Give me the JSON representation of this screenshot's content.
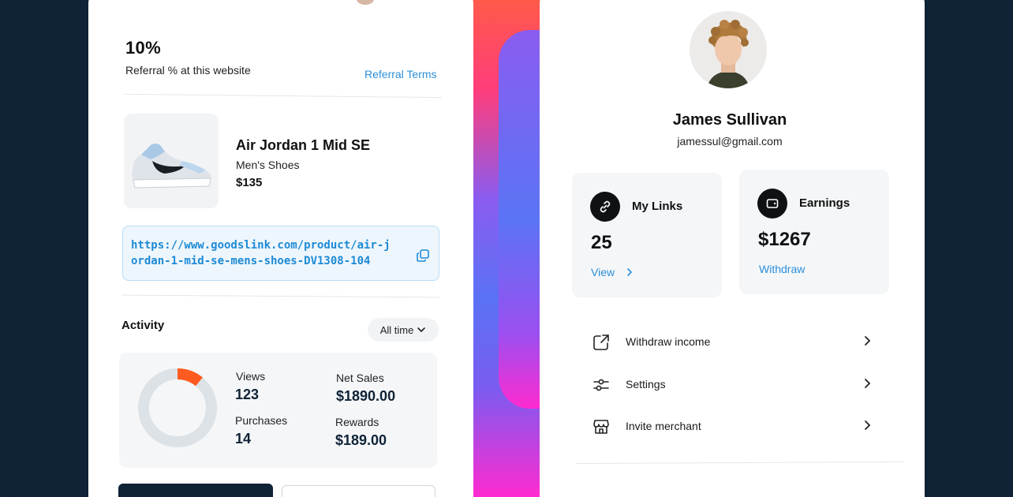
{
  "referral": {
    "percent": "10%",
    "subtitle": "Referral % at this website",
    "terms_link": "Referral Terms"
  },
  "product": {
    "name": "Air Jordan 1 Mid SE",
    "category": "Men's Shoes",
    "price": "$135",
    "link": "https://www.goodslink.com/product/air-jordan-1-mid-se-mens-shoes-DV1308-104"
  },
  "activity": {
    "title": "Activity",
    "filter": "All time",
    "progress_fraction": 0.11,
    "stats": [
      {
        "label": "Views",
        "value": "123"
      },
      {
        "label": "Net Sales",
        "value": "$1890.00"
      },
      {
        "label": "Purchases",
        "value": "14"
      },
      {
        "label": "Rewards",
        "value": "$189.00"
      }
    ]
  },
  "profile": {
    "name": "James Sullivan",
    "email": "jamessul@gmail.com"
  },
  "cards": {
    "links": {
      "title": "My Links",
      "value": "25",
      "action": "View"
    },
    "earnings": {
      "title": "Earnings",
      "value": "$1267",
      "action": "Withdraw"
    }
  },
  "menu": [
    {
      "label": "Withdraw income",
      "icon": "external-link-icon"
    },
    {
      "label": "Settings",
      "icon": "sliders-icon"
    },
    {
      "label": "Invite merchant",
      "icon": "store-icon"
    }
  ],
  "colors": {
    "accent": "#2b8fd9",
    "dark": "#0f2236",
    "progress": "#ff5a1f",
    "track": "#dde2e6"
  }
}
